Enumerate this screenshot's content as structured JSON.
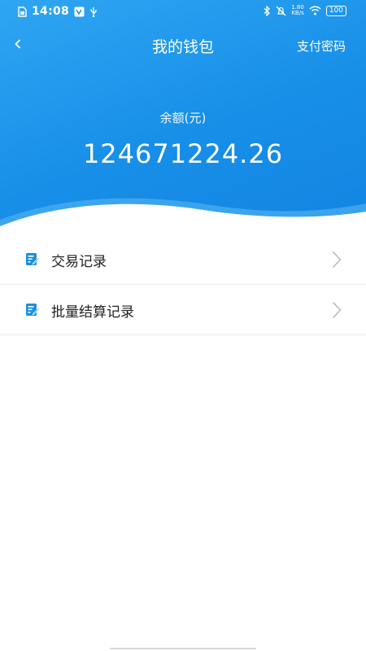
{
  "status_bar": {
    "time": "14:08",
    "net_speed_value": "1.80",
    "net_speed_unit": "KB/s",
    "battery": "100"
  },
  "nav": {
    "title": "我的钱包",
    "right_action": "支付密码"
  },
  "balance": {
    "label": "余额(元)",
    "amount": "124671224.26"
  },
  "menu": {
    "items": [
      {
        "label": "交易记录",
        "icon": "edit-note-icon"
      },
      {
        "label": "批量结算记录",
        "icon": "edit-note-icon"
      }
    ]
  },
  "colors": {
    "header_gradient_start": "#2fa6f2",
    "header_gradient_end": "#1384e2",
    "icon_blue": "#1a8fe0"
  }
}
